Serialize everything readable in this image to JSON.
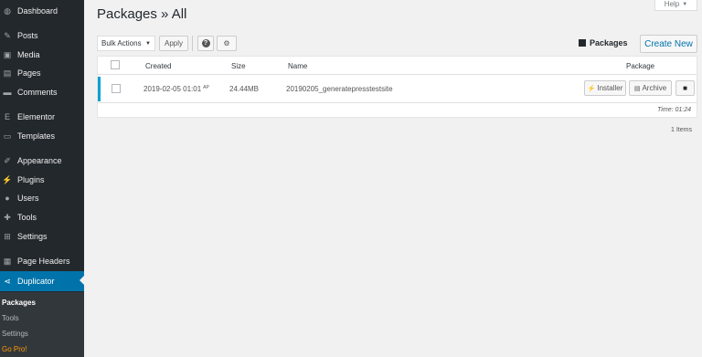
{
  "sidebar": {
    "items": [
      {
        "label": "Dashboard",
        "icon": "dashboard-icon",
        "glyph": "◍"
      },
      {
        "label": "Posts",
        "icon": "pin-icon",
        "glyph": "✎"
      },
      {
        "label": "Media",
        "icon": "media-icon",
        "glyph": "▣"
      },
      {
        "label": "Pages",
        "icon": "pages-icon",
        "glyph": "▤"
      },
      {
        "label": "Comments",
        "icon": "comment-icon",
        "glyph": "▬"
      },
      {
        "label": "Elementor",
        "icon": "elementor-icon",
        "glyph": "E"
      },
      {
        "label": "Templates",
        "icon": "folder-icon",
        "glyph": "▭"
      },
      {
        "label": "Appearance",
        "icon": "brush-icon",
        "glyph": "✐"
      },
      {
        "label": "Plugins",
        "icon": "plug-icon",
        "glyph": "⚡"
      },
      {
        "label": "Users",
        "icon": "user-icon",
        "glyph": "●"
      },
      {
        "label": "Tools",
        "icon": "wrench-icon",
        "glyph": "✚"
      },
      {
        "label": "Settings",
        "icon": "settings-icon",
        "glyph": "⊞"
      },
      {
        "label": "Page Headers",
        "icon": "grid-icon",
        "glyph": "▦"
      },
      {
        "label": "Duplicator",
        "icon": "share-icon",
        "glyph": "⋖"
      }
    ],
    "submenu": [
      "Packages",
      "Tools",
      "Settings",
      "Go Pro!"
    ]
  },
  "header": {
    "title": "Packages » All",
    "help_label": "Help",
    "help_caret": "▼"
  },
  "toolbar": {
    "bulk_actions": "Bulk Actions",
    "bulk_caret": "▼",
    "apply_label": "Apply",
    "question_glyph": "?",
    "gear_glyph": "⚙",
    "packages_label": "Packages",
    "create_new_label": "Create New"
  },
  "table": {
    "columns": [
      "Created",
      "Size",
      "Name",
      "Package"
    ],
    "rows": [
      {
        "created": "2019-02-05 01:01",
        "created_sup": "AP",
        "size": "24.44MB",
        "name": "20190205_generatepresstestsite",
        "installer_label": "Installer",
        "installer_glyph": "⚡",
        "archive_label": "Archive",
        "archive_glyph": "▤",
        "details_glyph": "■"
      }
    ],
    "time": "Time: 01:24"
  },
  "footer": {
    "items_count": "1 Items"
  },
  "colors": {
    "sidebar_bg": "#23282d",
    "active_bg": "#0073aa",
    "link": "#0073aa",
    "row_accent": "#00a0d2",
    "gopro": "#ff9a00"
  }
}
